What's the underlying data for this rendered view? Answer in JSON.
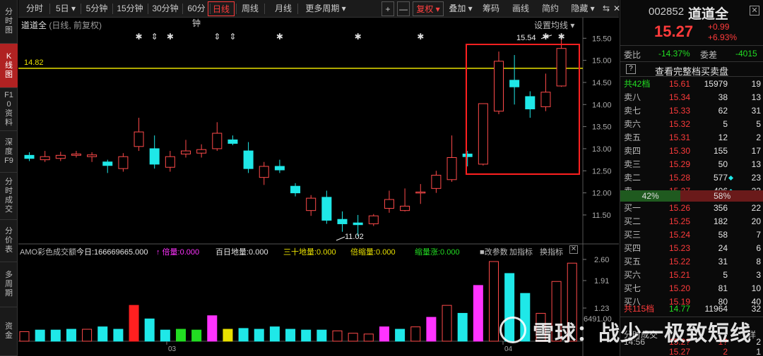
{
  "left_nav": [
    {
      "label": "分时图",
      "active": false
    },
    {
      "label": "K线图",
      "active": true
    },
    {
      "label": "F10资料",
      "active": false
    },
    {
      "label": "深度F9",
      "active": false
    },
    {
      "label": "分时成交",
      "active": false
    },
    {
      "label": "分价表",
      "active": false
    },
    {
      "label": "多周期",
      "active": false
    },
    {
      "label": "资金",
      "active": false
    }
  ],
  "toolbar": {
    "periods": [
      "分时",
      "5日 ▾",
      "5分钟",
      "15分钟",
      "30分钟",
      "60分钟",
      "日线",
      "周线",
      "月线",
      "更多周期 ▾"
    ],
    "active_period": "日线",
    "plus": "+",
    "minus": "—",
    "fuquan": "复权 ▾",
    "diejia": "叠加 ▾",
    "chouma": "筹码",
    "huaxian": "画线",
    "jianyue": "简约",
    "yincang": "隐藏 ▾",
    "expand": "⇆",
    "close": "✕"
  },
  "chart": {
    "stock_name": "道道全",
    "mode": "(日线, 前复权)",
    "settings": "设置均线 ▾",
    "ref_price_label": "14.82",
    "high_label": "15.54",
    "low_label": "11.02",
    "y_ticks": [
      "15.50",
      "15.00",
      "14.50",
      "14.00",
      "13.50",
      "13.00",
      "12.50",
      "12.00",
      "11.50"
    ],
    "x_ticks": [
      "03",
      "04"
    ],
    "accent": "#ff3b3b",
    "down_color": "#1fe8e8",
    "ref_line_color": "#e8e000"
  },
  "chart_data": {
    "type": "candlestick",
    "ylim": [
      11.1,
      15.68
    ],
    "ref_line": 14.82,
    "candles": [
      {
        "o": 12.85,
        "h": 12.92,
        "l": 12.72,
        "c": 12.78
      },
      {
        "o": 12.75,
        "h": 12.95,
        "l": 12.7,
        "c": 12.82
      },
      {
        "o": 12.78,
        "h": 12.93,
        "l": 12.72,
        "c": 12.85
      },
      {
        "o": 12.85,
        "h": 12.95,
        "l": 12.8,
        "c": 12.88
      },
      {
        "o": 12.82,
        "h": 12.92,
        "l": 12.7,
        "c": 12.86
      },
      {
        "o": 12.7,
        "h": 12.75,
        "l": 12.45,
        "c": 12.62
      },
      {
        "o": 12.55,
        "h": 12.9,
        "l": 12.48,
        "c": 12.82
      },
      {
        "o": 13.05,
        "h": 13.7,
        "l": 12.95,
        "c": 13.38
      },
      {
        "o": 13.0,
        "h": 13.3,
        "l": 12.55,
        "c": 12.65
      },
      {
        "o": 12.58,
        "h": 12.95,
        "l": 12.48,
        "c": 12.82
      },
      {
        "o": 12.88,
        "h": 13.2,
        "l": 12.8,
        "c": 12.95
      },
      {
        "o": 12.9,
        "h": 13.1,
        "l": 12.8,
        "c": 12.98
      },
      {
        "o": 13.0,
        "h": 13.6,
        "l": 12.95,
        "c": 13.35
      },
      {
        "o": 13.2,
        "h": 13.3,
        "l": 13.08,
        "c": 13.12
      },
      {
        "o": 12.95,
        "h": 13.15,
        "l": 12.45,
        "c": 12.55
      },
      {
        "o": 12.35,
        "h": 12.7,
        "l": 12.18,
        "c": 12.6
      },
      {
        "o": 12.6,
        "h": 12.75,
        "l": 12.45,
        "c": 12.52
      },
      {
        "o": 12.15,
        "h": 12.22,
        "l": 11.92,
        "c": 12.0
      },
      {
        "o": 11.6,
        "h": 11.95,
        "l": 11.48,
        "c": 11.88
      },
      {
        "o": 11.9,
        "h": 12.05,
        "l": 11.3,
        "c": 11.38
      },
      {
        "o": 11.4,
        "h": 11.58,
        "l": 11.12,
        "c": 11.3
      },
      {
        "o": 11.32,
        "h": 11.5,
        "l": 11.02,
        "c": 11.28
      },
      {
        "o": 11.3,
        "h": 11.52,
        "l": 11.25,
        "c": 11.48
      },
      {
        "o": 11.65,
        "h": 12.05,
        "l": 11.55,
        "c": 11.85
      },
      {
        "o": 11.6,
        "h": 12.1,
        "l": 11.58,
        "c": 11.7
      },
      {
        "o": 12.0,
        "h": 12.2,
        "l": 11.75,
        "c": 12.02
      },
      {
        "o": 12.1,
        "h": 12.5,
        "l": 12.0,
        "c": 12.4
      },
      {
        "o": 12.3,
        "h": 13.3,
        "l": 12.25,
        "c": 12.8
      },
      {
        "o": 12.88,
        "h": 12.95,
        "l": 12.6,
        "c": 12.82
      },
      {
        "o": 12.65,
        "h": 14.02,
        "l": 12.62,
        "c": 14.02
      },
      {
        "o": 13.85,
        "h": 15.2,
        "l": 13.78,
        "c": 14.98
      },
      {
        "o": 14.55,
        "h": 15.12,
        "l": 14.0,
        "c": 14.4
      },
      {
        "o": 14.18,
        "h": 14.3,
        "l": 13.7,
        "c": 13.9
      },
      {
        "o": 13.95,
        "h": 14.7,
        "l": 13.85,
        "c": 14.28
      },
      {
        "o": 14.42,
        "h": 15.54,
        "l": 14.4,
        "c": 15.27
      }
    ],
    "volume": {
      "title": "AMO彩色成交额",
      "ylabels": [
        "2.60",
        "1.91",
        "1.23"
      ],
      "bottom_label": "6491.00",
      "values": [
        0.12,
        0.14,
        0.14,
        0.15,
        0.15,
        0.18,
        0.15,
        0.45,
        0.28,
        0.14,
        0.15,
        0.14,
        0.32,
        0.15,
        0.16,
        0.15,
        0.18,
        0.15,
        0.14,
        0.14,
        0.13,
        0.1,
        0.09,
        0.18,
        0.15,
        0.18,
        0.3,
        0.45,
        0.35,
        0.7,
        1.0,
        0.85,
        0.6,
        0.35,
        0.75,
        0.98
      ],
      "colors": [
        "red",
        "cyan",
        "cyan",
        "cyan",
        "red",
        "cyan",
        "cyan",
        "solid-red",
        "cyan",
        "cyan",
        "green",
        "green",
        "magenta",
        "yellow",
        "cyan",
        "cyan",
        "cyan",
        "cyan",
        "cyan",
        "cyan",
        "red",
        "red",
        "red",
        "magenta",
        "cyan",
        "red",
        "magenta",
        "red",
        "cyan",
        "magenta",
        "red",
        "cyan",
        "cyan",
        "red",
        "red",
        "red"
      ],
      "indicator_bar": [
        {
          "text": "AMO彩色成交额",
          "color": "#bbbbbb"
        },
        {
          "text": "今日:166669665.000",
          "color": "#e6e6e6"
        },
        {
          "text": "↑ 倍量:0.000",
          "color": "#ff33ff"
        },
        {
          "text": "百日地量:0.000",
          "color": "#e6e6e6"
        },
        {
          "text": "三十地量:0.000",
          "color": "#e8e000"
        },
        {
          "text": "倍缩量:0.000",
          "color": "#e8e000"
        },
        {
          "text": "缩量涨:0.000",
          "color": "#22dd22"
        },
        {
          "text": "■改参数",
          "color": "#bbbbbb"
        },
        {
          "text": "加指标",
          "color": "#bbbbbb"
        },
        {
          "text": "换指标",
          "color": "#bbbbbb"
        }
      ]
    }
  },
  "quote": {
    "code": "002852",
    "name": "道道全",
    "price": "15.27",
    "change": "+0.99",
    "pct": "+6.93%",
    "weibi_label": "委比",
    "weibi": "-14.37%",
    "weicha_label": "委差",
    "weicha": "-4015",
    "full_book_q": "?",
    "full_book": "查看完整档买卖盘",
    "sell_total_label": "共42档",
    "sell_total_price": "15.61",
    "sell_total_vol": "15979",
    "sell_total_cnt": "19",
    "sells": [
      {
        "label": "卖八",
        "price": "15.34",
        "vol": "38",
        "cnt": "13"
      },
      {
        "label": "卖七",
        "price": "15.33",
        "vol": "62",
        "cnt": "31"
      },
      {
        "label": "卖六",
        "price": "15.32",
        "vol": "5",
        "cnt": "5"
      },
      {
        "label": "卖五",
        "price": "15.31",
        "vol": "12",
        "cnt": "2"
      },
      {
        "label": "卖四",
        "price": "15.30",
        "vol": "155",
        "cnt": "17"
      },
      {
        "label": "卖三",
        "price": "15.29",
        "vol": "50",
        "cnt": "13"
      },
      {
        "label": "卖二",
        "price": "15.28",
        "vol": "577",
        "cnt": "23"
      },
      {
        "label": "卖一",
        "price": "15.27",
        "vol": "406",
        "cnt": "23"
      }
    ],
    "sell_pct": "42%",
    "buy_pct": "58%",
    "buys": [
      {
        "label": "买一",
        "price": "15.26",
        "vol": "356",
        "cnt": "22"
      },
      {
        "label": "买二",
        "price": "15.25",
        "vol": "182",
        "cnt": "20"
      },
      {
        "label": "买三",
        "price": "15.24",
        "vol": "58",
        "cnt": "7"
      },
      {
        "label": "买四",
        "price": "15.23",
        "vol": "24",
        "cnt": "6"
      },
      {
        "label": "买五",
        "price": "15.22",
        "vol": "31",
        "cnt": "8"
      },
      {
        "label": "买六",
        "price": "15.21",
        "vol": "5",
        "cnt": "3"
      },
      {
        "label": "买七",
        "price": "15.20",
        "vol": "81",
        "cnt": "10"
      },
      {
        "label": "买八",
        "price": "15.19",
        "vol": "80",
        "cnt": "40"
      }
    ],
    "buy_total_label": "共115档",
    "buy_total_price": "14.77",
    "buy_total_vol": "11964",
    "buy_total_cnt": "32",
    "ticks_title": "分时成交",
    "ticks_detail": "详",
    "ticks": [
      {
        "time": "14:56",
        "price": "15.2?",
        "vol": "1?",
        "cnt": "2"
      },
      {
        "time": "",
        "price": "15.27",
        "vol": "2",
        "cnt": "1"
      }
    ]
  },
  "watermark": "雪球：战少一极致短线"
}
